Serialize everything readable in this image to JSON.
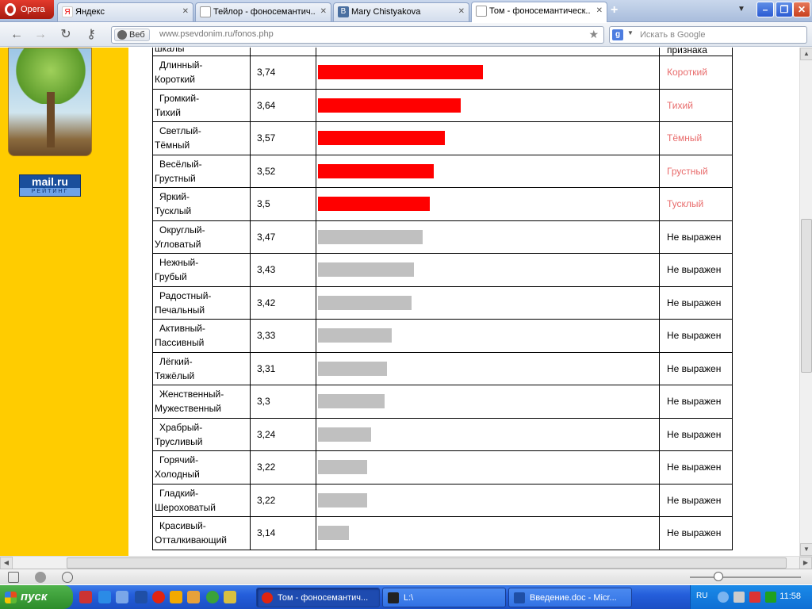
{
  "browser": {
    "opera_label": "Opera",
    "tabs": [
      {
        "label": "Яндекс",
        "icon": "yandex-icon",
        "active": false
      },
      {
        "label": "Тейлор - фоносемантич...",
        "icon": "page-icon",
        "active": false
      },
      {
        "label": "Mary Chistyakova",
        "icon": "vk-icon",
        "active": false
      },
      {
        "label": "Том - фоносемантическ...",
        "icon": "page-icon",
        "active": true
      }
    ],
    "address": {
      "badge": "Веб",
      "url": "www.psevdonim.ru/fonos.php"
    },
    "search": {
      "placeholder": "Искать в Google"
    }
  },
  "sidebar": {
    "logo_big": "mail.ru",
    "logo_small": "РЕЙТИНГ"
  },
  "colors": {
    "expressed_bar": "#ff0000",
    "neutral_bar": "#c0c0c0",
    "expressed_text": "#e86b6b",
    "sidebar_bg": "#ffcc00"
  },
  "table": {
    "header": {
      "scale": "шкалы",
      "sign": "признака"
    },
    "rows": [
      {
        "pair": [
          "Длинный-",
          "Короткий"
        ],
        "value": "3,74",
        "result": "Короткий",
        "expressed": true
      },
      {
        "pair": [
          "Громкий-",
          "Тихий"
        ],
        "value": "3,64",
        "result": "Тихий",
        "expressed": true
      },
      {
        "pair": [
          "Светлый-",
          "Тёмный"
        ],
        "value": "3,57",
        "result": "Тёмный",
        "expressed": true
      },
      {
        "pair": [
          "Весёлый-",
          "Грустный"
        ],
        "value": "3,52",
        "result": "Грустный",
        "expressed": true
      },
      {
        "pair": [
          "Яркий-",
          "Тусклый"
        ],
        "value": "3,5",
        "result": "Тусклый",
        "expressed": true
      },
      {
        "pair": [
          "Округлый-",
          "Угловатый"
        ],
        "value": "3,47",
        "result": "Не выражен",
        "expressed": false
      },
      {
        "pair": [
          "Нежный-",
          "Грубый"
        ],
        "value": "3,43",
        "result": "Не выражен",
        "expressed": false
      },
      {
        "pair": [
          "Радостный-",
          "Печальный"
        ],
        "value": "3,42",
        "result": "Не выражен",
        "expressed": false
      },
      {
        "pair": [
          "Активный-",
          "Пассивный"
        ],
        "value": "3,33",
        "result": "Не выражен",
        "expressed": false
      },
      {
        "pair": [
          "Лёгкий-",
          "Тяжёлый"
        ],
        "value": "3,31",
        "result": "Не выражен",
        "expressed": false
      },
      {
        "pair": [
          "Женственный-",
          "Мужественный"
        ],
        "value": "3,3",
        "result": "Не выражен",
        "expressed": false
      },
      {
        "pair": [
          "Храбрый-",
          "Трусливый"
        ],
        "value": "3,24",
        "result": "Не выражен",
        "expressed": false
      },
      {
        "pair": [
          "Горячий-",
          "Холодный"
        ],
        "value": "3,22",
        "result": "Не выражен",
        "expressed": false
      },
      {
        "pair": [
          "Гладкий-",
          "Шероховатый"
        ],
        "value": "3,22",
        "result": "Не выражен",
        "expressed": false
      },
      {
        "pair": [
          "Красивый-",
          "Отталкивающий"
        ],
        "value": "3,14",
        "result": "Не выражен",
        "expressed": false
      }
    ]
  },
  "chart_data": {
    "type": "bar",
    "orientation": "horizontal",
    "categories": [
      "Длинный-Короткий",
      "Громкий-Тихий",
      "Светлый-Тёмный",
      "Весёлый-Грустный",
      "Яркий-Тусклый",
      "Округлый-Угловатый",
      "Нежный-Грубый",
      "Радостный-Печальный",
      "Активный-Пассивный",
      "Лёгкий-Тяжёлый",
      "Женственный-Мужественный",
      "Храбрый-Трусливый",
      "Горячий-Холодный",
      "Гладкий-Шероховатый",
      "Красивый-Отталкивающий"
    ],
    "values": [
      3.74,
      3.64,
      3.57,
      3.52,
      3.5,
      3.47,
      3.43,
      3.42,
      3.33,
      3.31,
      3.3,
      3.24,
      3.22,
      3.22,
      3.14
    ],
    "scale_min": 3.0,
    "grid": false
  },
  "taskbar": {
    "start_label": "пуск",
    "tasks": [
      {
        "label": "Том - фоносемантич...",
        "active": true
      },
      {
        "label": "L:\\",
        "active": false
      },
      {
        "label": "Введение.doc - Micr...",
        "active": false
      }
    ],
    "lang": "RU",
    "clock": "11:58"
  }
}
